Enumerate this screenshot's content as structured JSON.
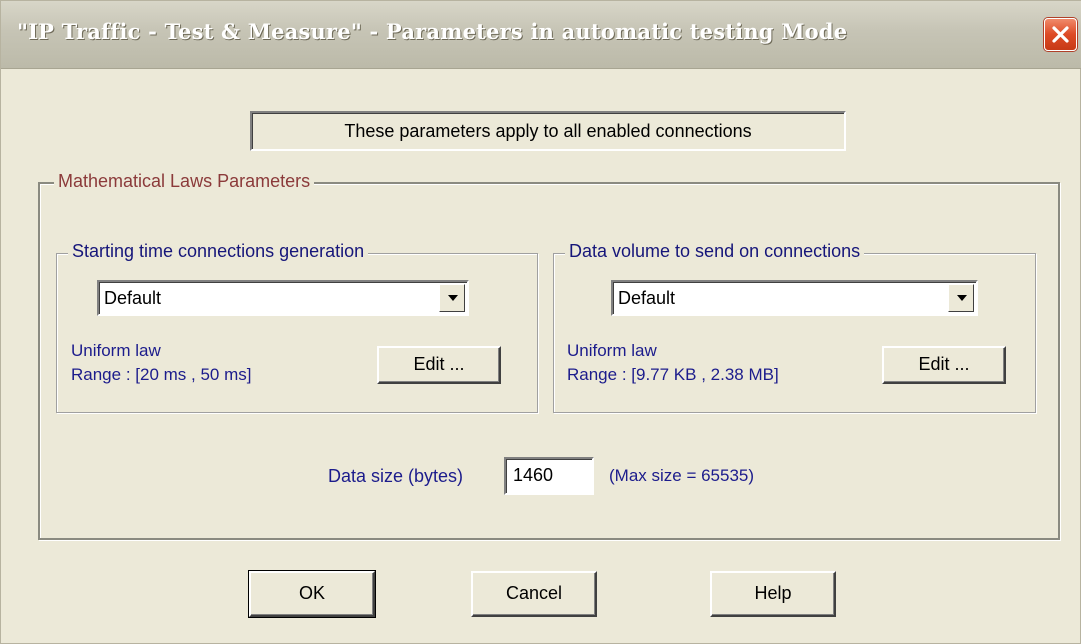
{
  "window": {
    "title": "\"IP Traffic - Test & Measure\" - Parameters in automatic testing Mode"
  },
  "banner": {
    "text": "These parameters apply to all enabled connections"
  },
  "math_group": {
    "legend": "Mathematical Laws Parameters"
  },
  "starting_time": {
    "legend": "Starting time connections generation",
    "selected": "Default",
    "law": "Uniform law",
    "range": "Range : [20 ms , 50 ms]",
    "edit_label": "Edit ..."
  },
  "data_volume": {
    "legend": "Data volume to send on connections",
    "selected": "Default",
    "law": "Uniform law",
    "range": "Range : [9.77 KB , 2.38 MB]",
    "edit_label": "Edit ..."
  },
  "data_size": {
    "label": "Data size (bytes)",
    "value": "1460",
    "max_note": "(Max size = 65535)"
  },
  "buttons": {
    "ok": "OK",
    "cancel": "Cancel",
    "help": "Help"
  },
  "icons": {
    "close": "close-icon",
    "dropdown": "chevron-down-icon"
  },
  "colors": {
    "close_button": "#dd4a25",
    "label_text": "#1c1c8c",
    "group_legend": "#8b3a3a"
  }
}
